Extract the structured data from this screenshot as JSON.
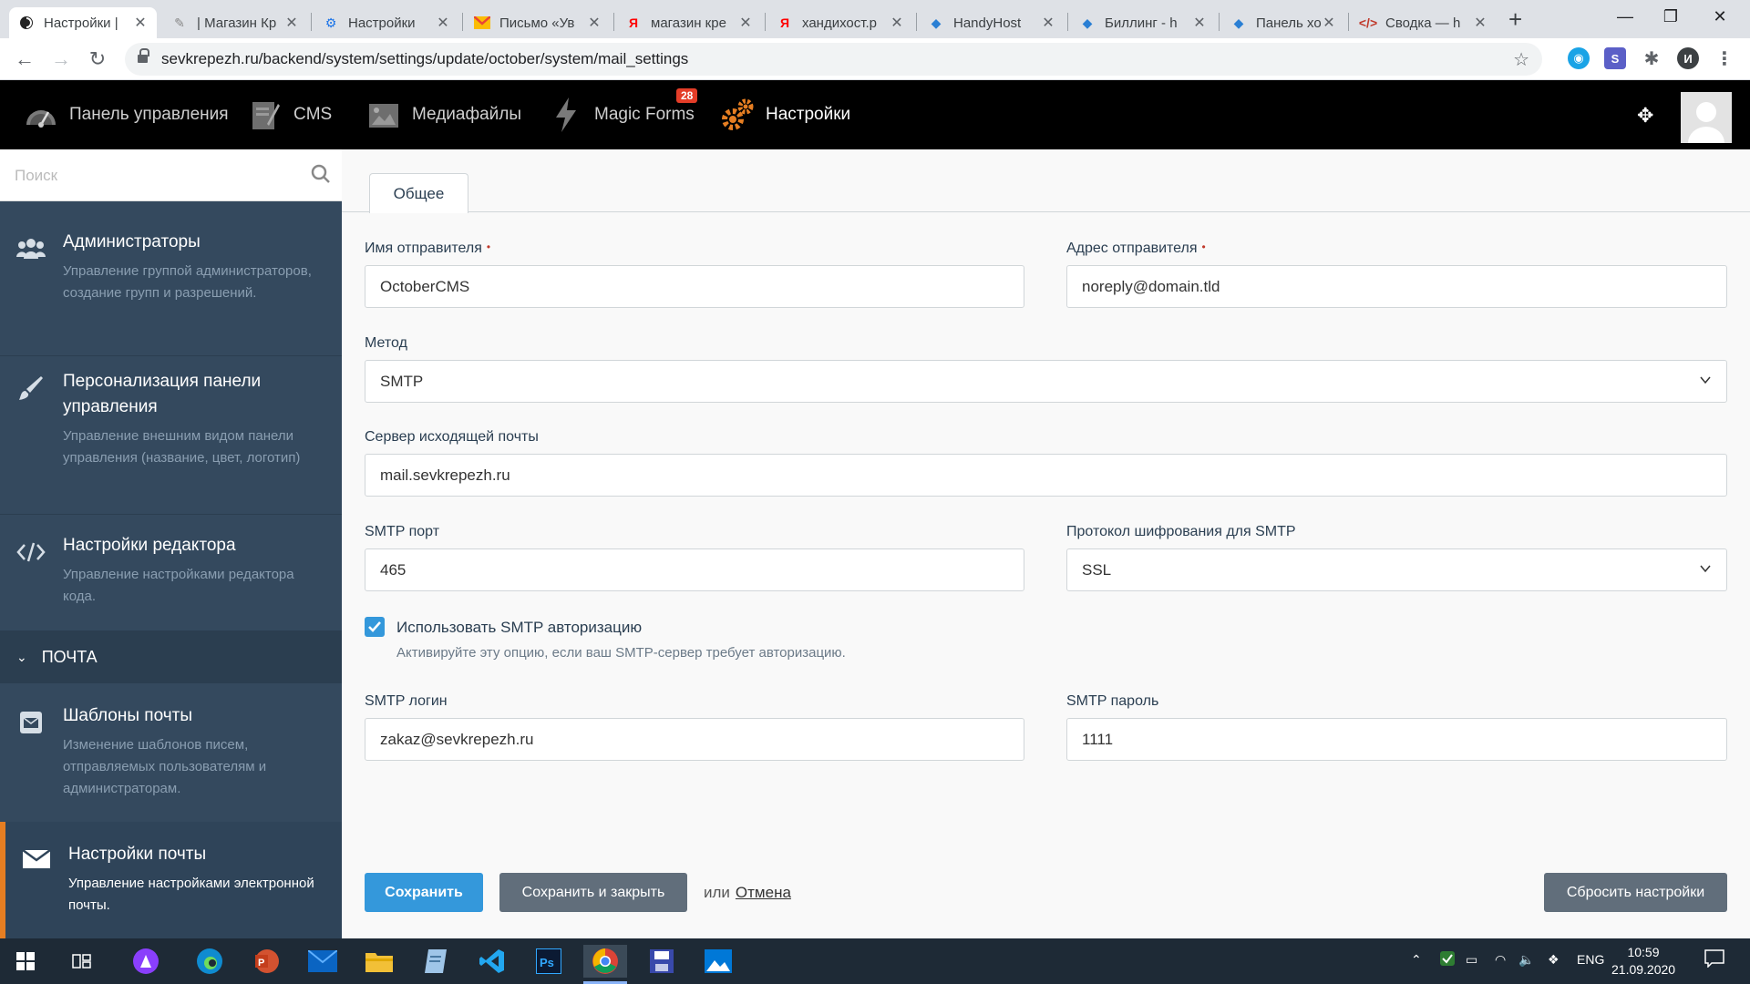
{
  "browser": {
    "tabs": [
      {
        "title": "Настройки | ",
        "favicon": "october-icon"
      },
      {
        "title": "| Магазин Кр",
        "favicon": "october-icon"
      },
      {
        "title": "Настройки",
        "favicon": "gear-icon"
      },
      {
        "title": "Письмо «Ув",
        "favicon": "mail-icon"
      },
      {
        "title": "магазин кре",
        "favicon": "yandex-icon"
      },
      {
        "title": "хандихост.р",
        "favicon": "yandex-icon"
      },
      {
        "title": "HandyHost",
        "favicon": "handyhost-icon"
      },
      {
        "title": "Биллинг - h",
        "favicon": "handyhost-icon"
      },
      {
        "title": "Панель хост",
        "favicon": "handyhost-icon"
      },
      {
        "title": "Сводка — h",
        "favicon": "code-icon"
      }
    ],
    "url": "sevkrepezh.ru/backend/system/settings/update/october/system/mail_settings",
    "profile_initial": "И"
  },
  "cms_nav": {
    "items": [
      {
        "label": "Панель управления",
        "icon": "dashboard-icon"
      },
      {
        "label": "CMS",
        "icon": "cms-icon"
      },
      {
        "label": "Медиафайлы",
        "icon": "media-icon"
      },
      {
        "label": "Magic Forms",
        "icon": "lightning-icon"
      },
      {
        "label": "Настройки",
        "icon": "settings-gears-icon"
      }
    ],
    "badge": "28"
  },
  "sidebar": {
    "search_placeholder": "Поиск",
    "items": [
      {
        "title": "Администраторы",
        "desc": "Управление группой администраторов, создание групп и разрешений."
      },
      {
        "title": "Персонализация панели управления",
        "desc": "Управление внешним видом панели управления (название, цвет, логотип)"
      },
      {
        "title": "Настройки редактора",
        "desc": "Управление настройками редактора кода."
      }
    ],
    "section": "ПОЧТА",
    "mail_items": [
      {
        "title": "Шаблоны почты",
        "desc": "Изменение шаблонов писем, отправляемых пользователям и администраторам."
      },
      {
        "title": "Настройки почты",
        "desc": "Управление настройками электронной почты."
      }
    ]
  },
  "form": {
    "tab": "Общее",
    "sender_name": {
      "label": "Имя отправителя",
      "value": "OctoberCMS"
    },
    "sender_email": {
      "label": "Адрес отправителя",
      "value": "noreply@domain.tld"
    },
    "method": {
      "label": "Метод",
      "value": "SMTP"
    },
    "smtp_server": {
      "label": "Сервер исходящей почты",
      "value": "mail.sevkrepezh.ru"
    },
    "smtp_port": {
      "label": "SMTP порт",
      "value": "465"
    },
    "smtp_encryption": {
      "label": "Протокол шифрования для SMTP",
      "value": "SSL"
    },
    "smtp_auth": {
      "label": "Использовать SMTP авторизацию",
      "help": "Активируйте эту опцию, если ваш SMTP-сервер требует авторизацию.",
      "checked": true
    },
    "smtp_login": {
      "label": "SMTP логин",
      "value": "zakaz@sevkrepezh.ru"
    },
    "smtp_password": {
      "label": "SMTP пароль",
      "value": "1111"
    },
    "required_mark": "•",
    "buttons": {
      "save": "Сохранить",
      "save_close": "Сохранить и закрыть",
      "or": "или",
      "cancel": "Отмена",
      "reset": "Сбросить настройки"
    }
  },
  "taskbar": {
    "lang": "ENG",
    "time": "10:59",
    "date": "21.09.2020"
  },
  "colors": {
    "primary": "#3498db",
    "sidebar": "#34495e",
    "accent": "#e67e22",
    "badge": "#e43d28"
  }
}
